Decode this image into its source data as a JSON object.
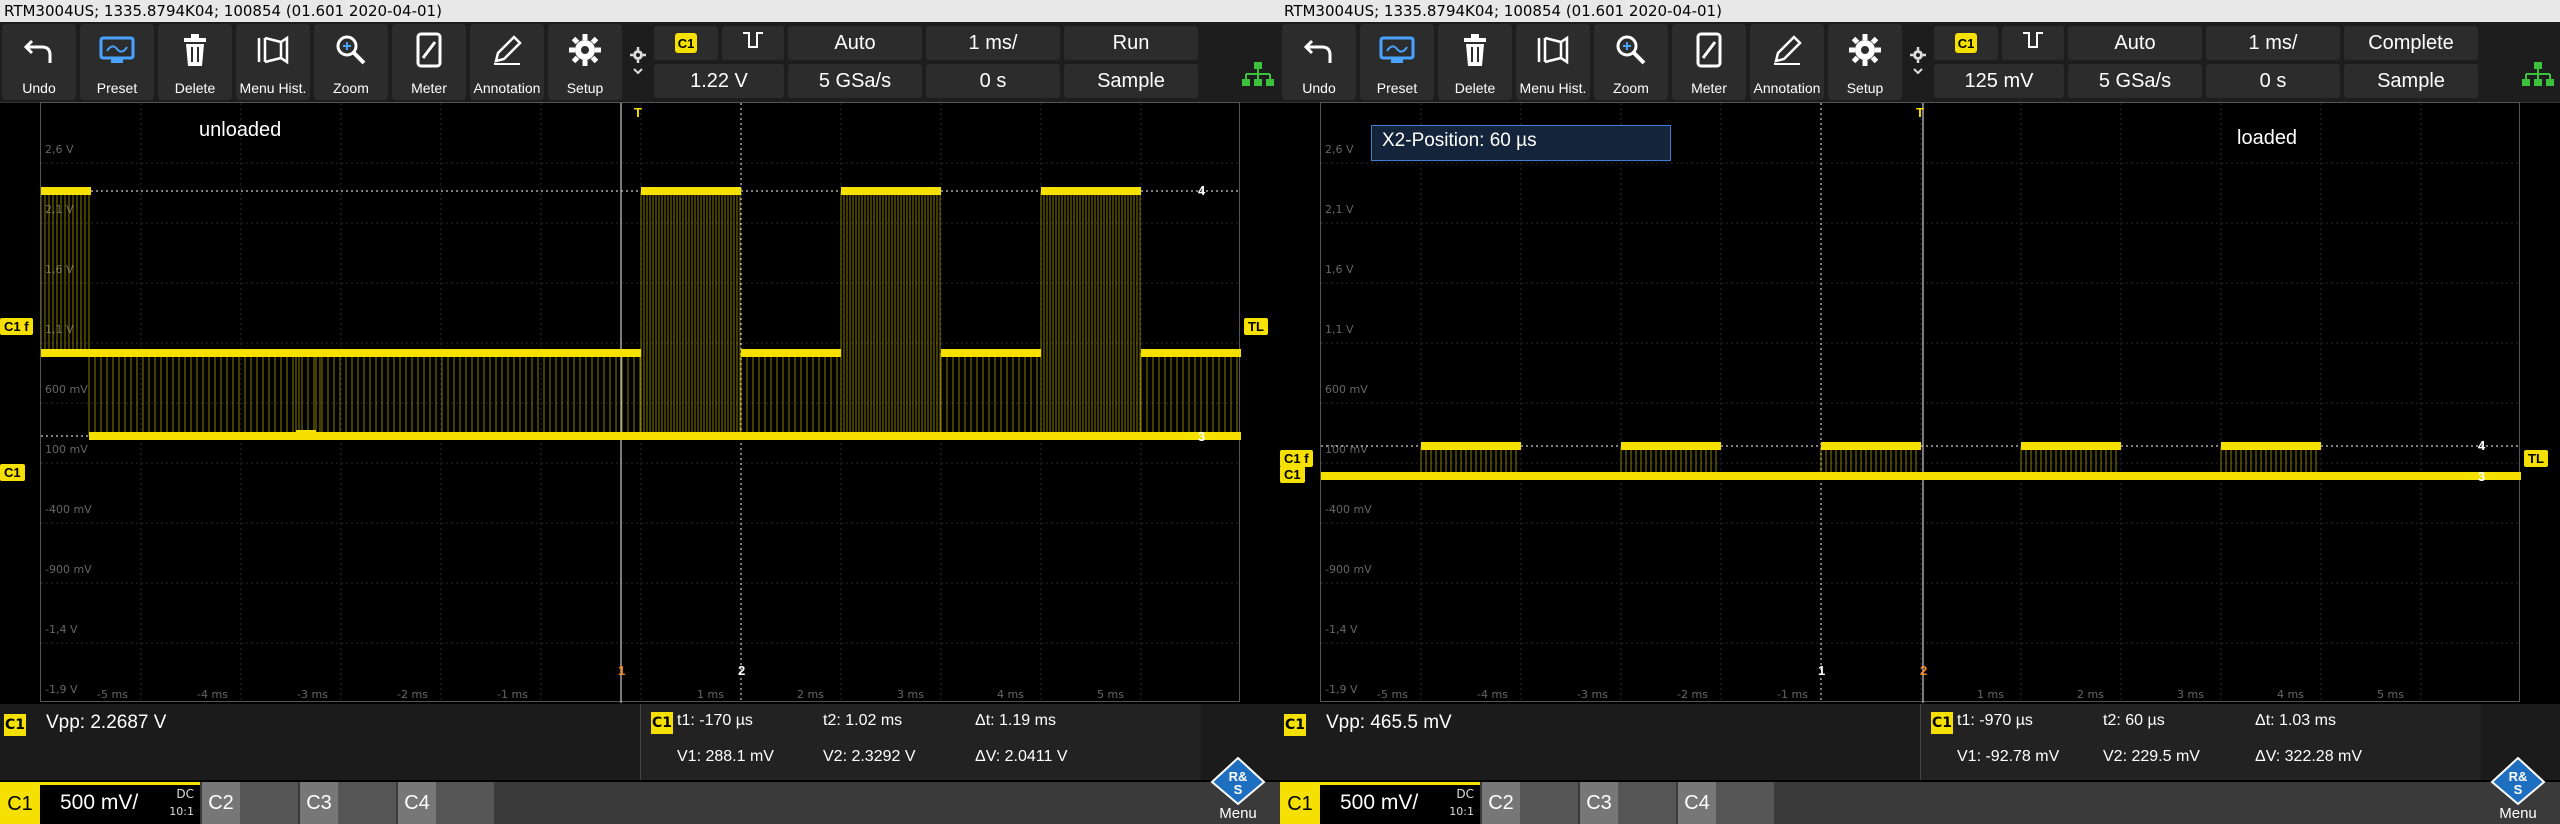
{
  "scopes": [
    {
      "info": "RTM3004US; 1335.8794K04; 100854 (01.601 2020-04-01)",
      "toolbar": [
        {
          "label": "Undo",
          "icon": "undo-icon"
        },
        {
          "label": "Preset",
          "icon": "preset-icon"
        },
        {
          "label": "Delete",
          "icon": "delete-icon"
        },
        {
          "label": "Menu Hist.",
          "icon": "menu-history-icon"
        },
        {
          "label": "Zoom",
          "icon": "zoom-icon"
        },
        {
          "label": "Meter",
          "icon": "meter-icon"
        },
        {
          "label": "Annotation",
          "icon": "annotation-icon"
        },
        {
          "label": "Setup",
          "icon": "setup-gear-icon"
        }
      ],
      "trigger": {
        "source": "C1",
        "level": "1.22 V",
        "mode": "Auto",
        "rate": "5 GSa/s",
        "timebase": "1 ms/",
        "delay": "0 s",
        "run_state": "Run",
        "acq": "Sample"
      },
      "annotation": "unloaded",
      "markers": {
        "tl": "TL",
        "c1": "C1",
        "c1f": "C1 f",
        "t": "T",
        "cur1": "1",
        "cur2": "2",
        "h4": "4",
        "h3": "3"
      },
      "y_ticks": [
        "2,6 V",
        "2,1 V",
        "1,6 V",
        "1,1 V",
        "600 mV",
        "100 mV",
        "-400 mV",
        "-900 mV",
        "-1,4 V",
        "-1,9 V"
      ],
      "x_ticks": [
        "-5 ms",
        "-4 ms",
        "-3 ms",
        "-2 ms",
        "-1 ms",
        "1 ms",
        "2 ms",
        "3 ms",
        "4 ms",
        "5 ms"
      ],
      "measurement": {
        "tag": "C1",
        "text": "Vpp: 2.2687 V"
      },
      "cursor": {
        "tag": "C1",
        "t1": "t1: -170 µs",
        "t2": "t2: 1.02 ms",
        "dt": "Δt: 1.19 ms",
        "v1": "V1: 288.1 mV",
        "v2": "V2: 2.3292 V",
        "dv": "ΔV: 2.0411 V"
      },
      "channel": {
        "name": "C1",
        "scale": "500 mV/",
        "coupling": "DC",
        "probe": "10:1",
        "others": [
          "C2",
          "C3",
          "C4"
        ]
      },
      "menu_label": "Menu"
    },
    {
      "info": "RTM3004US; 1335.8794K04; 100854 (01.601 2020-04-01)",
      "toolbar": [
        {
          "label": "Undo",
          "icon": "undo-icon"
        },
        {
          "label": "Preset",
          "icon": "preset-icon"
        },
        {
          "label": "Delete",
          "icon": "delete-icon"
        },
        {
          "label": "Menu Hist.",
          "icon": "menu-history-icon"
        },
        {
          "label": "Zoom",
          "icon": "zoom-icon"
        },
        {
          "label": "Meter",
          "icon": "meter-icon"
        },
        {
          "label": "Annotation",
          "icon": "annotation-icon"
        },
        {
          "label": "Setup",
          "icon": "setup-gear-icon"
        }
      ],
      "trigger": {
        "source": "C1",
        "level": "125 mV",
        "mode": "Auto",
        "rate": "5 GSa/s",
        "timebase": "1 ms/",
        "delay": "0 s",
        "run_state": "Complete",
        "acq": "Sample"
      },
      "annotation": "loaded",
      "x2_popup": "X2-Position: 60 µs",
      "markers": {
        "tl": "TL",
        "c1": "C1",
        "c1f": "C1 f",
        "t": "T",
        "cur1": "1",
        "cur2": "2",
        "h4": "4",
        "h3": "3"
      },
      "y_ticks": [
        "2,6 V",
        "2,1 V",
        "1,6 V",
        "1,1 V",
        "600 mV",
        "100 mV",
        "-400 mV",
        "-900 mV",
        "-1,4 V",
        "-1,9 V"
      ],
      "x_ticks": [
        "-5 ms",
        "-4 ms",
        "-3 ms",
        "-2 ms",
        "-1 ms",
        "1 ms",
        "2 ms",
        "3 ms",
        "4 ms",
        "5 ms"
      ],
      "measurement": {
        "tag": "C1",
        "text": "Vpp: 465.5 mV"
      },
      "cursor": {
        "tag": "C1",
        "t1": "t1: -970 µs",
        "t2": "t2: 60 µs",
        "dt": "Δt: 1.03 ms",
        "v1": "V1: -92.78 mV",
        "v2": "V2: 229.5 mV",
        "dv": "ΔV: 322.28 mV"
      },
      "channel": {
        "name": "C1",
        "scale": "500 mV/",
        "coupling": "DC",
        "probe": "10:1",
        "others": [
          "C2",
          "C3",
          "C4"
        ]
      },
      "menu_label": "Menu"
    }
  ],
  "colors": {
    "trace": "#f5e000",
    "grid": "#2e2e2e",
    "accent": "#3b7fd0",
    "cursor": "#ffffff",
    "marker_orange": "#ff8c1a",
    "network": "#3cc13c"
  }
}
